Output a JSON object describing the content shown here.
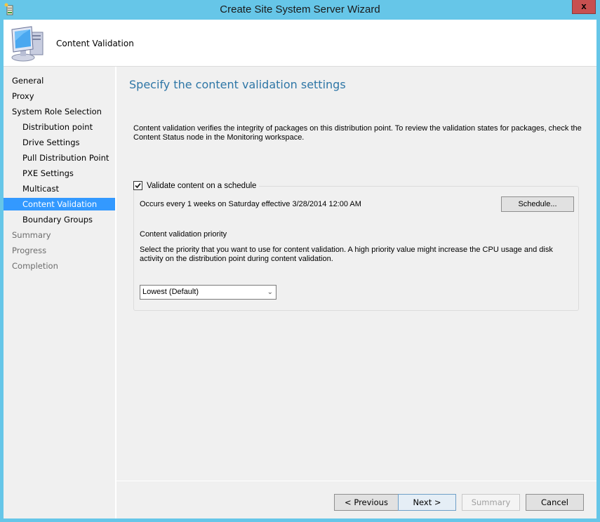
{
  "window": {
    "title": "Create Site System Server Wizard",
    "close_label": "x",
    "icons": {
      "app": "wizard-app-icon",
      "close": "close-icon",
      "header": "computer-icon"
    }
  },
  "header": {
    "title": "Content Validation"
  },
  "nav": {
    "items": [
      {
        "label": "General",
        "level": 0,
        "state": "done"
      },
      {
        "label": "Proxy",
        "level": 0,
        "state": "done"
      },
      {
        "label": "System Role Selection",
        "level": 0,
        "state": "done"
      },
      {
        "label": "Distribution point",
        "level": 1,
        "state": "done"
      },
      {
        "label": "Drive Settings",
        "level": 1,
        "state": "done"
      },
      {
        "label": "Pull Distribution Point",
        "level": 1,
        "state": "done"
      },
      {
        "label": "PXE Settings",
        "level": 1,
        "state": "done"
      },
      {
        "label": "Multicast",
        "level": 1,
        "state": "done"
      },
      {
        "label": "Content Validation",
        "level": 1,
        "state": "selected"
      },
      {
        "label": "Boundary Groups",
        "level": 1,
        "state": "enabled"
      },
      {
        "label": "Summary",
        "level": 0,
        "state": "disabled"
      },
      {
        "label": "Progress",
        "level": 0,
        "state": "disabled"
      },
      {
        "label": "Completion",
        "level": 0,
        "state": "disabled"
      }
    ]
  },
  "main": {
    "title": "Specify the content validation settings",
    "description": "Content validation verifies the integrity of packages on this distribution point. To review the validation states for packages, check the Content Status node in the Monitoring workspace.",
    "validate_checkbox": {
      "label": "Validate content on a schedule",
      "checked": true
    },
    "schedule_text": "Occurs every 1 weeks on Saturday effective 3/28/2014 12:00 AM",
    "schedule_button": "Schedule...",
    "priority_label": "Content validation priority",
    "priority_description": "Select the priority that you want to use for content validation. A high priority value might increase the CPU usage and disk activity on the distribution point during content validation.",
    "priority_select": {
      "value": "Lowest (Default)",
      "icon": "chevron-down-icon"
    }
  },
  "footer": {
    "previous": "< Previous",
    "next": "Next >",
    "summary": "Summary",
    "cancel": "Cancel"
  },
  "colors": {
    "accent_title": "#2e76a6",
    "selection": "#3399ff",
    "frame": "#66c6e8",
    "close": "#c75050"
  }
}
